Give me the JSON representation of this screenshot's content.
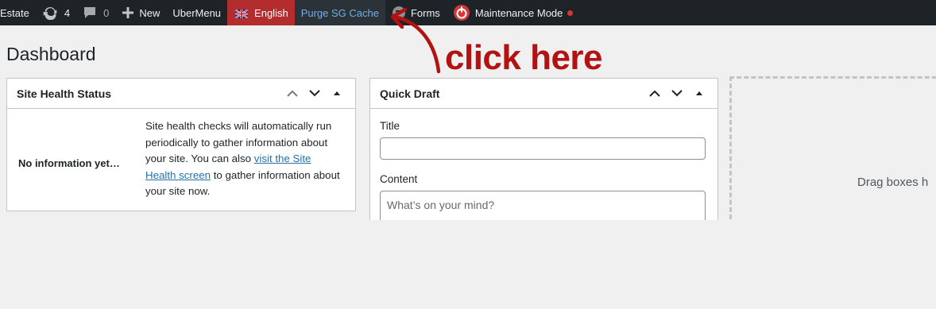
{
  "admin_bar": {
    "site_name": "Estate",
    "updates_count": "4",
    "comments_count": "0",
    "new_label": "New",
    "ubermenu_label": "UberMenu",
    "language_label": "English",
    "purge_label": "Purge SG Cache",
    "forms_label": "Forms",
    "maintenance_label": "Maintenance Mode",
    "colors": {
      "bar_bg": "#1d2327",
      "english_bg": "#b32d2e",
      "purge_text": "#72aee6",
      "status_dot": "#d63638"
    }
  },
  "page": {
    "title": "Dashboard"
  },
  "annotation": {
    "text": "click here",
    "color": "#b31212"
  },
  "site_health": {
    "title": "Site Health Status",
    "no_info": "No information yet…",
    "desc_before": "Site health checks will automatically run periodically to gather information about your site. You can also ",
    "link_text": "visit the Site Health screen",
    "desc_after": " to gather information about your site now."
  },
  "quick_draft": {
    "title": "Quick Draft",
    "title_label": "Title",
    "title_value": "",
    "content_label": "Content",
    "content_placeholder": "What’s on your mind?"
  },
  "drop_zone": {
    "text": "Drag boxes h"
  },
  "icons": [
    "updates-icon",
    "comments-icon",
    "plus-icon",
    "uk-flag-icon",
    "forms-icon",
    "maintenance-icon",
    "chevron-up-icon",
    "chevron-down-icon",
    "triangle-up-icon"
  ]
}
